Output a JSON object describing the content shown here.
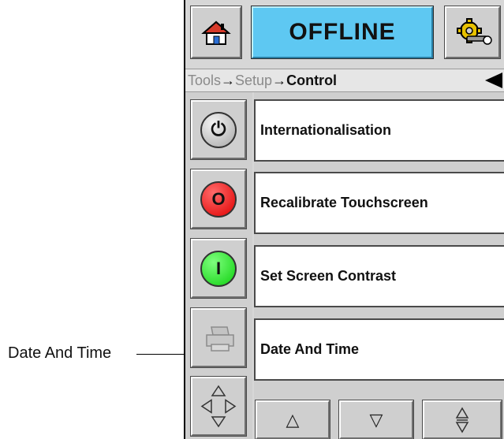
{
  "header": {
    "status_text": "OFFLINE",
    "home_icon": "home-icon",
    "tools_icon": "gear-tools-icon"
  },
  "breadcrumb": {
    "items": [
      "Tools",
      "Setup",
      "Control"
    ],
    "separator": "→"
  },
  "side_buttons": {
    "power_symbol": "⏻",
    "stop_label": "O",
    "start_label": "I"
  },
  "menu": {
    "items": [
      "Internationalisation",
      "Recalibrate Touchscreen",
      "Set Screen Contrast",
      "Date And Time"
    ]
  },
  "bottom_nav": {
    "up": "△",
    "down": "▽",
    "updown": "⬍"
  },
  "callout": {
    "label": "Date And Time"
  },
  "colors": {
    "status_bg": "#5ec8f2",
    "stop": "#e00000",
    "start": "#10d010"
  }
}
